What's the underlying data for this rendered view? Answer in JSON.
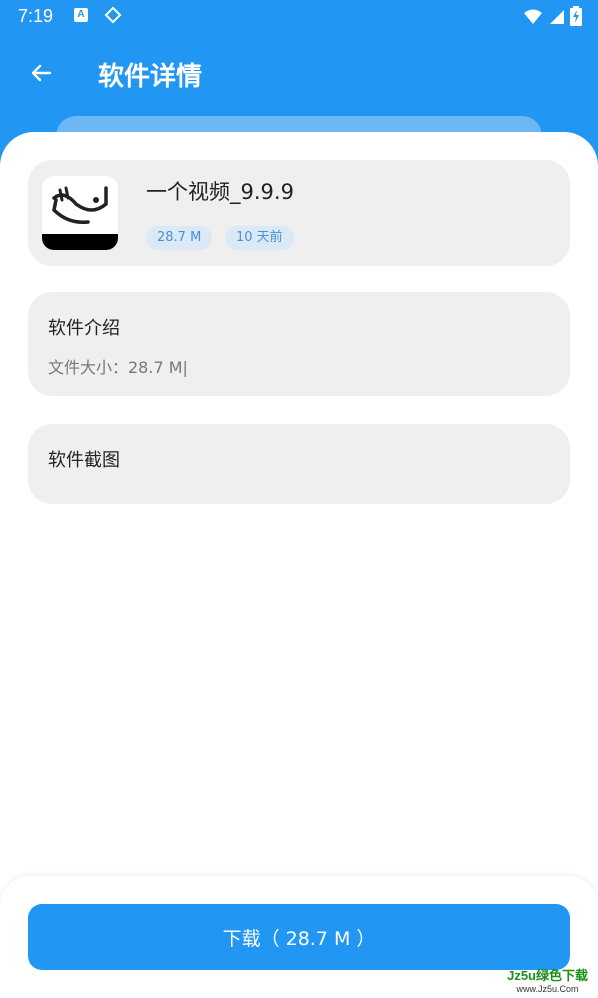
{
  "status_bar": {
    "time": "7:19",
    "icon_a": "A"
  },
  "app_bar": {
    "title": "软件详情"
  },
  "app_card": {
    "name": "一个视频_9.9.9",
    "size_tag": "28.7 M",
    "time_tag": "10 天前"
  },
  "intro_card": {
    "title": "软件介绍",
    "text": "文件大小：28.7 M|"
  },
  "screenshots_card": {
    "title": "软件截图"
  },
  "download": {
    "label": "下载（ 28.7 M ）"
  },
  "watermark": {
    "main": "Jz5u绿色下载",
    "sub": "www.Jz5u.Com"
  },
  "colors": {
    "primary": "#2196f3",
    "card_bg": "#efefef",
    "tag_bg": "#dbe9f7",
    "tag_text": "#4a90d9"
  }
}
